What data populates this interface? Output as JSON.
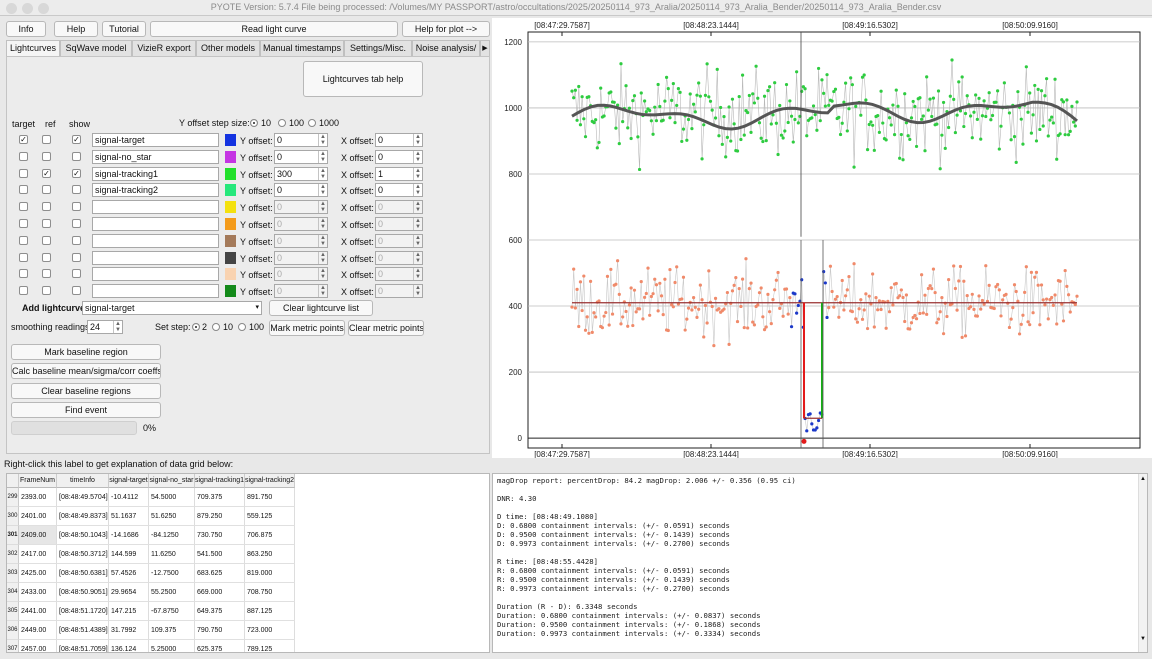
{
  "window": {
    "title": "PYOTE Version: 5.7.4  File being processed: /Volumes/MY PASSPORT/astro/occultations/2025/20250114_973_Aralia/20250114_973_Aralia_Bender/20250114_973_Aralia_Bender.csv"
  },
  "toolbar": {
    "info": "Info",
    "help": "Help",
    "tutorial": "Tutorial",
    "read_light_curve": "Read light curve",
    "help_for_plot": "Help for plot -->"
  },
  "tabs": [
    "Lightcurves",
    "SqWave model",
    "VizieR export",
    "Other models",
    "Manual timestamps",
    "Settings/Misc.",
    "Noise analysis/"
  ],
  "tab_scroll_arrow": "▶",
  "lc": {
    "help_button": "Lightcurves tab help",
    "hdr_target": "target",
    "hdr_ref": "ref",
    "hdr_show": "show",
    "y_step_label": "Y offset step size:",
    "y_step_options": [
      "10",
      "100",
      "1000"
    ],
    "y_offset_label": "Y offset:",
    "x_offset_label": "X offset:",
    "add_lightcurve_label": "Add lightcurve",
    "add_lightcurve_value": "signal-target",
    "clear_lightcurve_list": "Clear lightcurve list",
    "smoothing_label": "smoothing readings",
    "smoothing_value": "24",
    "set_step_label": "Set step:",
    "set_step_options": [
      "2",
      "10",
      "100"
    ],
    "mark_metric_points": "Mark metric points",
    "clear_metric_points": "Clear metric points",
    "mark_baseline": "Mark baseline region",
    "calc_baseline": "Calc baseline mean/sigma/corr coeffs",
    "clear_baseline": "Clear baseline regions",
    "find_event": "Find event",
    "progress_text": "0%",
    "progress_value": 0,
    "rows": [
      {
        "target": true,
        "ref": false,
        "show": true,
        "name": "signal-target",
        "color": "#1433e0",
        "y": "0",
        "x": "0",
        "enabled": true
      },
      {
        "target": false,
        "ref": false,
        "show": false,
        "name": "signal-no_star",
        "color": "#c535e3",
        "y": "0",
        "x": "0",
        "enabled": true
      },
      {
        "target": false,
        "ref": true,
        "show": true,
        "name": "signal-tracking1",
        "color": "#22e02a",
        "y": "300",
        "x": "1",
        "enabled": true
      },
      {
        "target": false,
        "ref": false,
        "show": false,
        "name": "signal-tracking2",
        "color": "#27e87c",
        "y": "0",
        "x": "0",
        "enabled": true
      },
      {
        "target": false,
        "ref": false,
        "show": false,
        "name": "",
        "color": "#f4e10f",
        "y": "0",
        "x": "0",
        "enabled": false
      },
      {
        "target": false,
        "ref": false,
        "show": false,
        "name": "",
        "color": "#f49b1a",
        "y": "0",
        "x": "0",
        "enabled": false
      },
      {
        "target": false,
        "ref": false,
        "show": false,
        "name": "",
        "color": "#a47a5a",
        "y": "0",
        "x": "0",
        "enabled": false
      },
      {
        "target": false,
        "ref": false,
        "show": false,
        "name": "",
        "color": "#444444",
        "y": "0",
        "x": "0",
        "enabled": false
      },
      {
        "target": false,
        "ref": false,
        "show": false,
        "name": "",
        "color": "#f9d3b1",
        "y": "0",
        "x": "0",
        "enabled": false
      },
      {
        "target": false,
        "ref": false,
        "show": false,
        "name": "",
        "color": "#138a1a",
        "y": "0",
        "x": "0",
        "enabled": false
      }
    ]
  },
  "chart_data": {
    "type": "scatter",
    "top_ticks": [
      "[08:47:29.7587]",
      "[08:48:23.1444]",
      "[08:49:16.5302]",
      "[08:50:09.9160]"
    ],
    "bottom_ticks": [
      "[08:47:29.7587]",
      "[08:48:23.1444]",
      "[08:49:16.5302]",
      "[08:50:09.9160]"
    ],
    "y_ticks": [
      "1200",
      "1000",
      "800",
      "600",
      "400",
      "200",
      "0"
    ],
    "ylim": [
      -30,
      1230
    ],
    "grid": true,
    "series": [
      {
        "color": "#2ecc40",
        "baseline": 985,
        "sigma": 110
      },
      {
        "color": "#f08a6a",
        "baseline": 410,
        "sigma": 75
      }
    ],
    "smooth_color": "#555555",
    "event_color": "#e31b1b",
    "event_fill": "#14b214",
    "event_points_color": "#1b38c9"
  },
  "grid_title": "Right-click this label to get explanation of data grid below:",
  "table": {
    "headers": [
      "FrameNum",
      "timeInfo",
      "signal-target",
      "signal-no_star",
      "signal-tracking1",
      "signal-tracking2"
    ],
    "rows": [
      {
        "idx": "299",
        "cells": [
          "2393.00",
          "[08:48:49.5704]",
          "-10.4112",
          "54.5000",
          "709.375",
          "891.750"
        ]
      },
      {
        "idx": "300",
        "cells": [
          "2401.00",
          "[08:48:49.8373]",
          "51.1637",
          "51.6250",
          "879.250",
          "559.125"
        ]
      },
      {
        "idx": "301",
        "cells": [
          "2409.00",
          "[08:48:50.1043]",
          "-14.1686",
          "-84.1250",
          "730.750",
          "706.875"
        ]
      },
      {
        "idx": "302",
        "cells": [
          "2417.00",
          "[08:48:50.3712]",
          "144.599",
          "11.6250",
          "541.500",
          "863.250"
        ]
      },
      {
        "idx": "303",
        "cells": [
          "2425.00",
          "[08:48:50.6381]",
          "57.4526",
          "-12.7500",
          "683.625",
          "819.000"
        ]
      },
      {
        "idx": "304",
        "cells": [
          "2433.00",
          "[08:48:50.9051]",
          "29.9654",
          "55.2500",
          "669.000",
          "708.750"
        ]
      },
      {
        "idx": "305",
        "cells": [
          "2441.00",
          "[08:48:51.1720]",
          "147.215",
          "-67.8750",
          "649.375",
          "887.125"
        ]
      },
      {
        "idx": "306",
        "cells": [
          "2449.00",
          "[08:48:51.4389]",
          "31.7992",
          "109.375",
          "790.750",
          "723.000"
        ]
      },
      {
        "idx": "307",
        "cells": [
          "2457.00",
          "[08:48:51.7059]",
          "136.124",
          "5.25000",
          "625.375",
          "789.125"
        ]
      }
    ]
  },
  "report_lines": [
    "magDrop report: percentDrop: 84.2 magDrop: 2.006 +/- 0.356 (0.95 ci)",
    "",
    "DNR: 4.30",
    "",
    "D time: [08:48:49.1080]",
    "D: 0.6800 containment intervals: (+/- 0.0591) seconds",
    "D: 0.9500 containment intervals: (+/- 0.1439) seconds",
    "D: 0.9973 containment intervals: (+/- 0.2700) seconds",
    "",
    "R time: [08:48:55.4428]",
    "R: 0.6800 containment intervals: (+/- 0.0591) seconds",
    "R: 0.9500 containment intervals: (+/- 0.1439) seconds",
    "R: 0.9973 containment intervals: (+/- 0.2700) seconds",
    "",
    "Duration (R - D): 6.3348 seconds",
    "Duration: 0.6800 containment intervals: (+/- 0.0837) seconds",
    "Duration: 0.9500 containment intervals: (+/- 0.1868) seconds",
    "Duration: 0.9973 containment intervals: (+/- 0.3334) seconds"
  ]
}
